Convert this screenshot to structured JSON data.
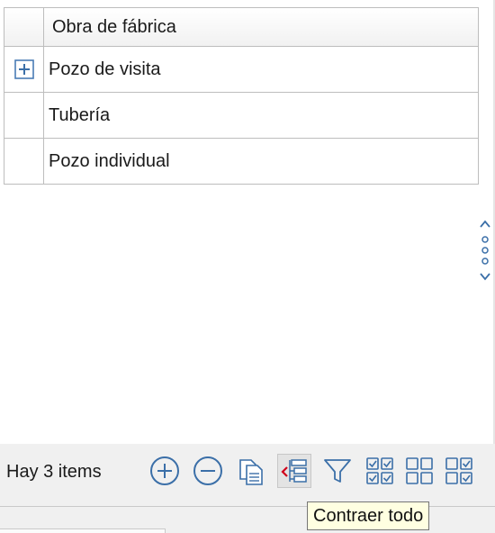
{
  "grid": {
    "header": {
      "column_label": "Obra de fábrica"
    },
    "rows": [
      {
        "label": "Pozo de visita",
        "expandable": true
      },
      {
        "label": "Tubería",
        "expandable": false
      },
      {
        "label": "Pozo individual",
        "expandable": false
      }
    ]
  },
  "footer": {
    "count_text": "Hay 3 items",
    "toolbar": [
      {
        "icon": "plus-circle-icon"
      },
      {
        "icon": "minus-circle-icon"
      },
      {
        "icon": "copy-document-icon"
      },
      {
        "icon": "collapse-all-icon",
        "active": true
      },
      {
        "icon": "filter-icon"
      },
      {
        "icon": "check-all-grid-icon"
      },
      {
        "icon": "uncheck-all-grid-icon"
      },
      {
        "icon": "invert-check-grid-icon"
      }
    ]
  },
  "tooltip": {
    "text": "Contraer todo"
  },
  "colors": {
    "accent": "#3b6fa8",
    "tooltip_bg": "#ffffe1",
    "grid_border": "#bdbdbd"
  }
}
